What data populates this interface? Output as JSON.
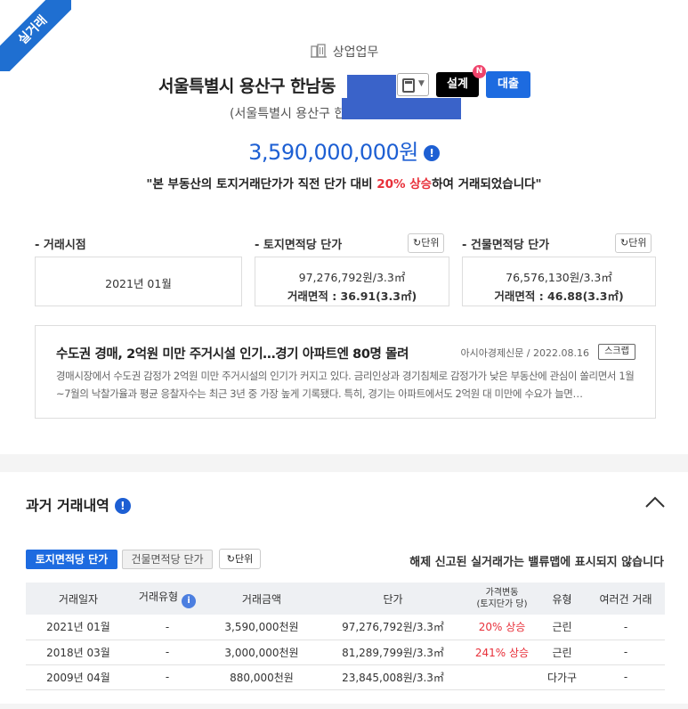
{
  "ribbon": "실거래",
  "category": "상업업무",
  "address": "서울특별시 용산구 한남동",
  "address_sub": "(서울특별시 용산구 한",
  "buttons": {
    "design": "설계",
    "design_badge": "N",
    "loan": "대출"
  },
  "price": "3,590,000,000원",
  "summary": {
    "pre": "\"본 부동산의 토지거래단가가 직전 단가 대비 ",
    "highlight": "20% 상승",
    "post": "하여 거래되었습니다\""
  },
  "sections": {
    "trade_time": {
      "label": "- 거래시점",
      "value": "2021년 01월"
    },
    "land_unit": {
      "label": "- 토지면적당 단가",
      "unit_button": "단위",
      "line1": "97,276,792원/3.3㎡",
      "line2": "거래면적 : 36.91(3.3㎡)"
    },
    "bld_unit": {
      "label": "- 건물면적당 단가",
      "unit_button": "단위",
      "line1": "76,576,130원/3.3㎡",
      "line2": "거래면적 : 46.88(3.3㎡)"
    }
  },
  "news": {
    "title": "수도권 경매, 2억원 미만 주거시설 인기…경기 아파트엔 80명 몰려",
    "source": "아시아경제신문 / 2022.08.16",
    "scrap": "스크랩",
    "body": "경매시장에서 수도권 감정가 2억원 미만 주거시설의 인기가 커지고 있다. 금리인상과 경기침체로 감정가가 낮은 부동산에 관심이 쏠리면서 1월~7월의 낙찰가율과 평균 응찰자수는 최근 3년 중 가장 높게 기록됐다. 특히, 경기는 아파트에서도 2억원 대 미만에 수요가 늘면…"
  },
  "history": {
    "title": "과거 거래내역",
    "tab_land": "토지면적당 단가",
    "tab_building": "건물면적당 단가",
    "unit_button": "단위",
    "notice": "해제 신고된 실거래가는 밸류맵에 표시되지 않습니다",
    "columns": [
      "거래일자",
      "거래유형",
      "거래금액",
      "단가",
      "가격변동",
      "(토지단가 당)",
      "유형",
      "여러건 거래"
    ],
    "rows": [
      {
        "date": "2021년 01월",
        "type": "-",
        "amount": "3,590,000천원",
        "unit": "97,276,792원/3.3㎡",
        "change": "20% 상승",
        "kind": "근린",
        "multi": "-"
      },
      {
        "date": "2018년 03월",
        "type": "-",
        "amount": "3,000,000천원",
        "unit": "81,289,799원/3.3㎡",
        "change": "241% 상승",
        "kind": "근린",
        "multi": "-"
      },
      {
        "date": "2009년 04월",
        "type": "-",
        "amount": "880,000천원",
        "unit": "23,845,008원/3.3㎡",
        "change": "",
        "kind": "다가구",
        "multi": "-"
      }
    ]
  },
  "colors": {
    "accent": "#1d6be0",
    "up": "#e8303a",
    "ribbon": "#1f6fd1"
  }
}
